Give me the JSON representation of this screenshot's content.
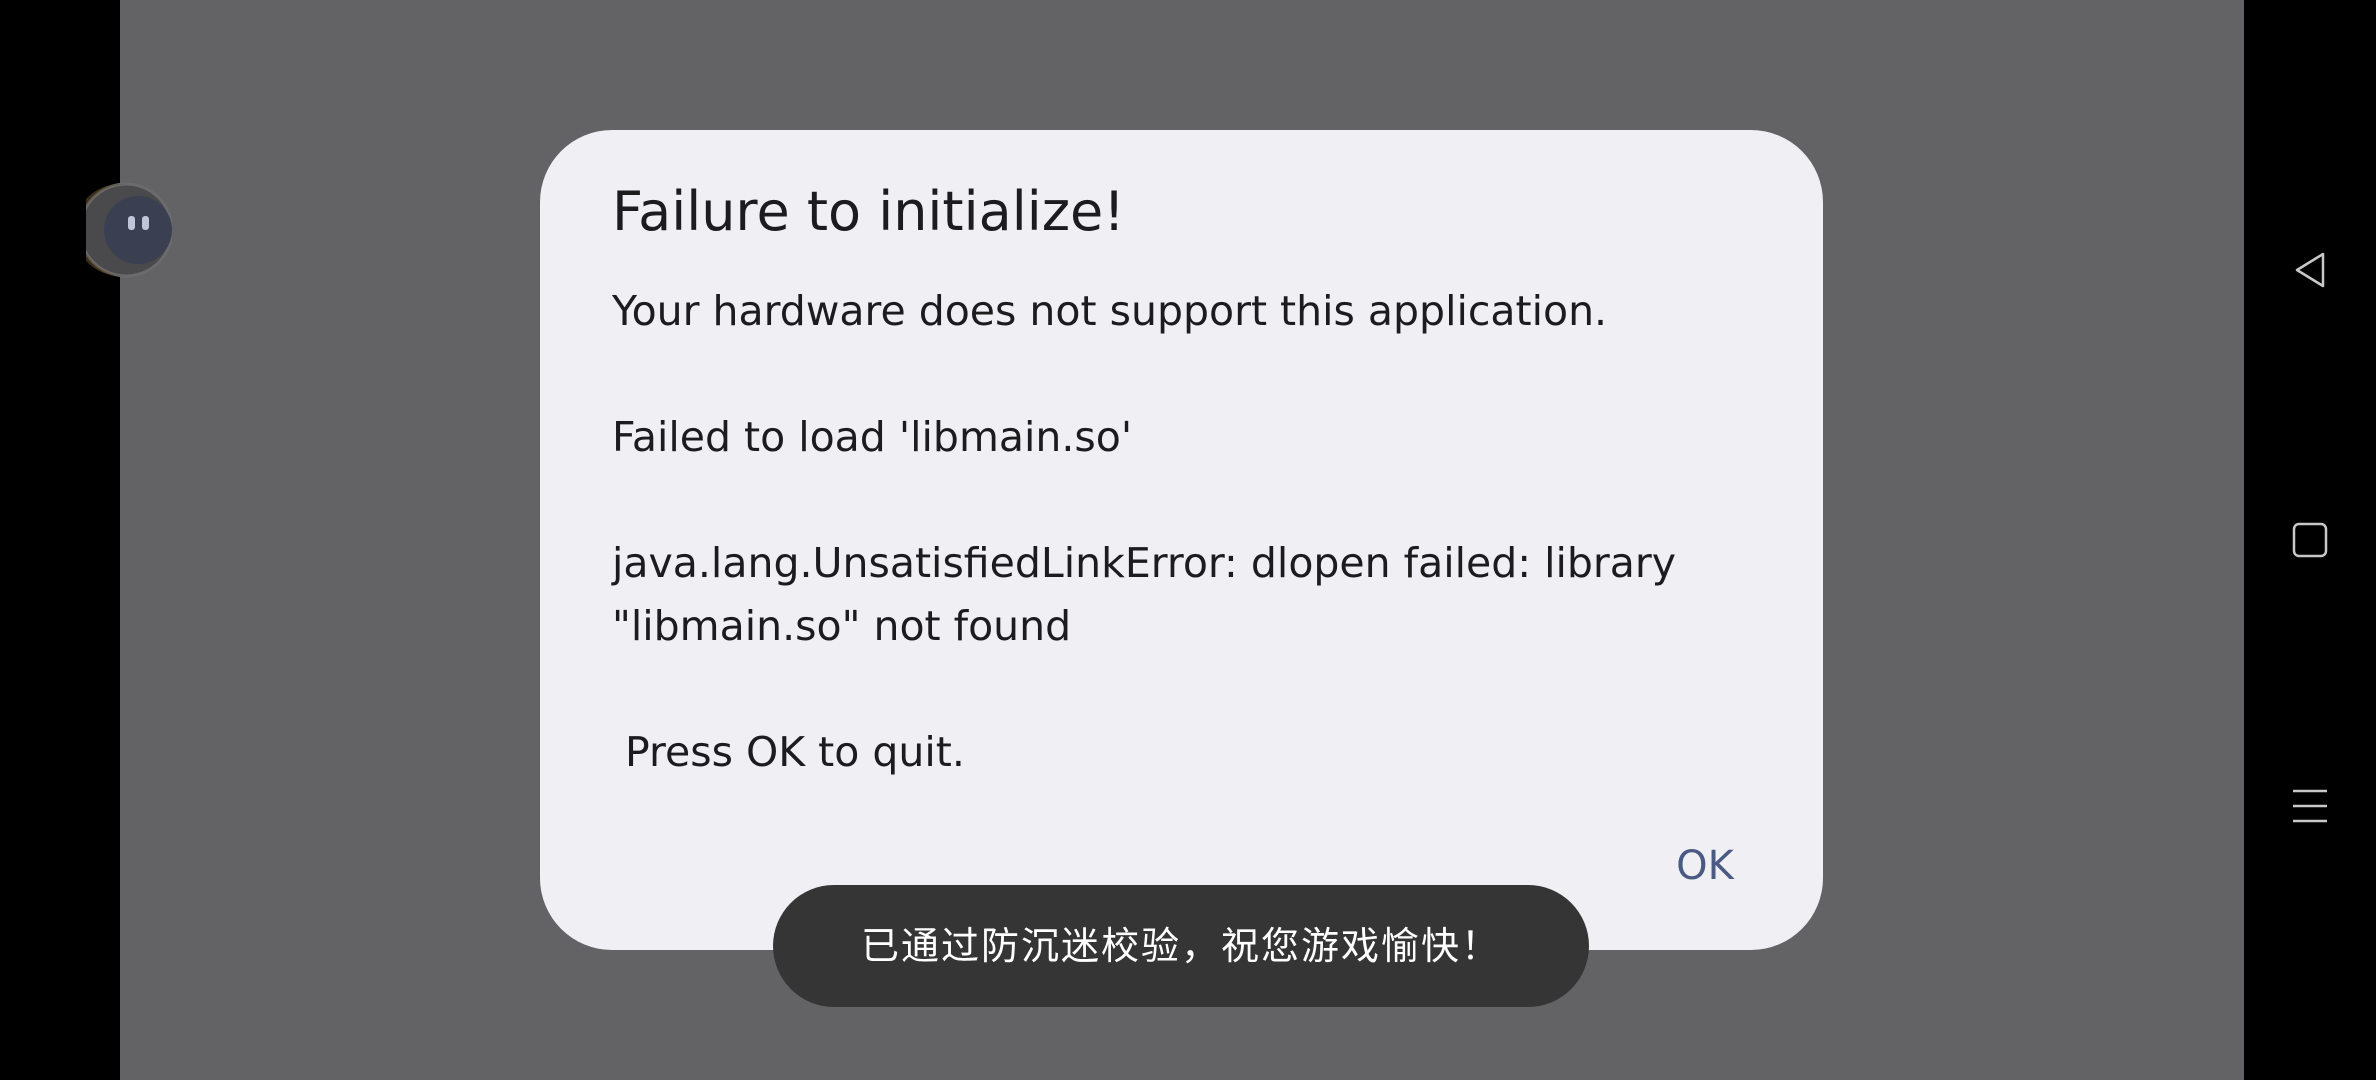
{
  "dialog": {
    "title": "Failure to initialize!",
    "message": "Your hardware does not support this application.\n\nFailed to load 'libmain.so'\n\njava.lang.UnsatisfiedLinkError: dlopen failed: library \"libmain.so\" not found\n\n Press OK to quit.",
    "ok_label": "OK"
  },
  "toast": {
    "text": "已通过防沉迷校验，祝您游戏愉快！"
  },
  "floating_ball": {
    "icon": "assistant-ball-icon"
  },
  "nav_bar": {
    "back_icon": "back-triangle-icon",
    "home_icon": "home-square-icon",
    "recents_icon": "menu-lines-icon"
  },
  "colors": {
    "scrim": "#636365",
    "dialog_bg": "#f0eff4",
    "ok_accent": "#4b5a82",
    "toast_bg": "#353535"
  }
}
